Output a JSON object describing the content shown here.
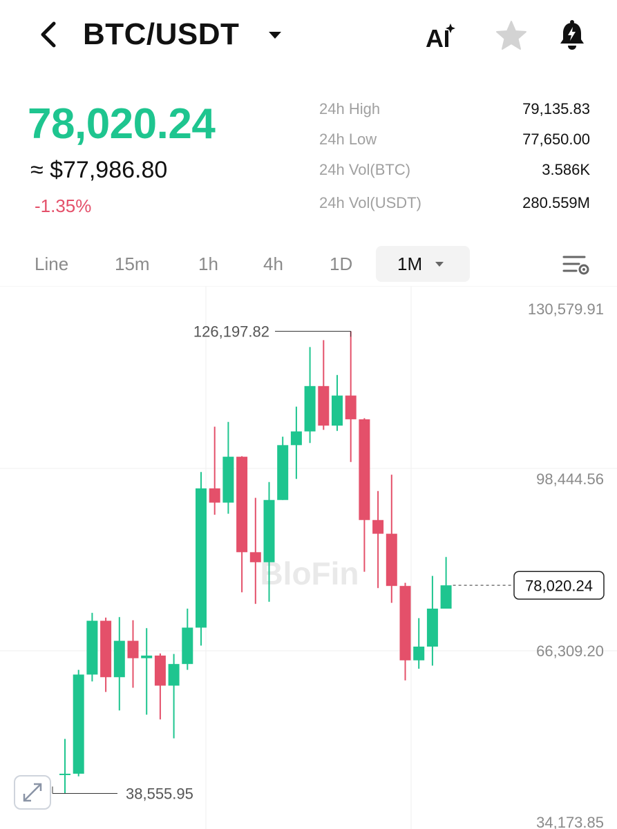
{
  "header": {
    "pair": "BTC/USDT",
    "back_icon": "chevron-left-icon",
    "caret_icon": "caret-down-icon",
    "ai_icon": "ai-sparkle-icon",
    "favorite_icon": "star-icon",
    "alert_icon": "bell-alert-icon"
  },
  "ticker": {
    "last_price": "78,020.24",
    "usd_equivalent": "≈ $77,986.80",
    "change_pct": "-1.35%",
    "up_color": "#1ec58f",
    "down_color": "#e4506a"
  },
  "stats": [
    {
      "label": "24h High",
      "value": "79,135.83"
    },
    {
      "label": "24h Low",
      "value": "77,650.00"
    },
    {
      "label": "24h Vol(BTC)",
      "value": "3.586K"
    },
    {
      "label": "24h Vol(USDT)",
      "value": "280.559M"
    }
  ],
  "intervals": {
    "items": [
      "Line",
      "15m",
      "1h",
      "4h",
      "1D",
      "1M"
    ],
    "selected": "1M",
    "settings_icon": "chart-settings-icon"
  },
  "chart_data": {
    "type": "candlestick",
    "interval": "1M",
    "y_axis_labels": [
      "130,579.91",
      "98,444.56",
      "66,309.20",
      "34,173.85"
    ],
    "ylim": [
      34173.85,
      130579.91
    ],
    "max_marker": "126,197.82",
    "min_marker": "38,555.95",
    "last_price_label": "78,020.24",
    "watermark": "BloFin",
    "candles": [
      {
        "o": 42300,
        "h": 48900,
        "l": 38556,
        "c": 42300
      },
      {
        "o": 42300,
        "h": 62000,
        "l": 41800,
        "c": 61100
      },
      {
        "o": 61100,
        "h": 72800,
        "l": 59800,
        "c": 71300
      },
      {
        "o": 71300,
        "h": 71900,
        "l": 57800,
        "c": 60600
      },
      {
        "o": 60600,
        "h": 72000,
        "l": 54300,
        "c": 67500
      },
      {
        "o": 67500,
        "h": 71400,
        "l": 58600,
        "c": 64200
      },
      {
        "o": 64200,
        "h": 69900,
        "l": 53500,
        "c": 64700
      },
      {
        "o": 64700,
        "h": 65100,
        "l": 52600,
        "c": 59000
      },
      {
        "o": 59000,
        "h": 65000,
        "l": 49000,
        "c": 63100
      },
      {
        "o": 63100,
        "h": 73600,
        "l": 62000,
        "c": 70000
      },
      {
        "o": 70000,
        "h": 99500,
        "l": 66600,
        "c": 96400
      },
      {
        "o": 96400,
        "h": 108100,
        "l": 91400,
        "c": 93700
      },
      {
        "o": 93700,
        "h": 109000,
        "l": 91600,
        "c": 102400
      },
      {
        "o": 102400,
        "h": 102500,
        "l": 76700,
        "c": 84300
      },
      {
        "o": 84300,
        "h": 94600,
        "l": 74500,
        "c": 82400
      },
      {
        "o": 82400,
        "h": 97600,
        "l": 74900,
        "c": 94200
      },
      {
        "o": 94200,
        "h": 106200,
        "l": 94200,
        "c": 104600
      },
      {
        "o": 104600,
        "h": 111900,
        "l": 98200,
        "c": 107200
      },
      {
        "o": 107200,
        "h": 123200,
        "l": 105000,
        "c": 115800
      },
      {
        "o": 115800,
        "h": 124500,
        "l": 107500,
        "c": 108300
      },
      {
        "o": 108300,
        "h": 117900,
        "l": 107300,
        "c": 114000
      },
      {
        "o": 114000,
        "h": 126198,
        "l": 101400,
        "c": 109500
      },
      {
        "o": 109500,
        "h": 109700,
        "l": 80600,
        "c": 90400
      },
      {
        "o": 90400,
        "h": 95900,
        "l": 77500,
        "c": 87800
      },
      {
        "o": 87800,
        "h": 99000,
        "l": 74700,
        "c": 77900
      },
      {
        "o": 77900,
        "h": 78500,
        "l": 60000,
        "c": 63800
      },
      {
        "o": 63800,
        "h": 71800,
        "l": 62200,
        "c": 66400
      },
      {
        "o": 66400,
        "h": 79800,
        "l": 62800,
        "c": 73600
      },
      {
        "o": 73600,
        "h": 83400,
        "l": 73600,
        "c": 78020.24
      }
    ]
  },
  "expand_icon": "expand-arrows-icon"
}
